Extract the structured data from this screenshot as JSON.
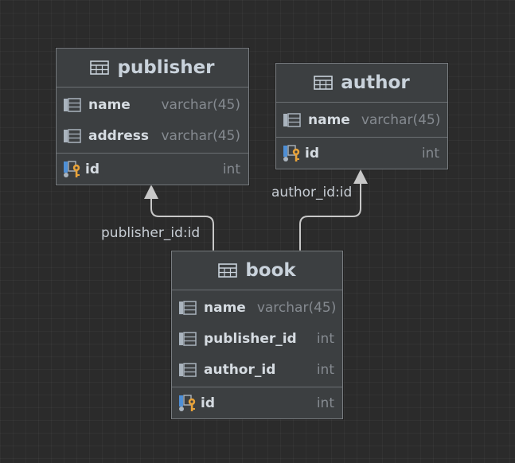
{
  "tables": {
    "publisher": {
      "name": "publisher",
      "columns": [
        {
          "name": "name",
          "type": "varchar(45)"
        },
        {
          "name": "address",
          "type": "varchar(45)"
        }
      ],
      "pk": {
        "name": "id",
        "type": "int"
      }
    },
    "author": {
      "name": "author",
      "columns": [
        {
          "name": "name",
          "type": "varchar(45)"
        }
      ],
      "pk": {
        "name": "id",
        "type": "int"
      }
    },
    "book": {
      "name": "book",
      "columns": [
        {
          "name": "name",
          "type": "varchar(45)"
        },
        {
          "name": "publisher_id",
          "type": "int"
        },
        {
          "name": "author_id",
          "type": "int"
        }
      ],
      "pk": {
        "name": "id",
        "type": "int"
      }
    }
  },
  "relations": {
    "publisher_link": {
      "label": "publisher_id:id",
      "from": "book",
      "to": "publisher"
    },
    "author_link": {
      "label": "author_id:id",
      "from": "book",
      "to": "author"
    }
  },
  "icons": {
    "table": "table-icon",
    "column": "column-icon",
    "primary_key": "primary-key-icon"
  },
  "colors": {
    "background": "#2b2b2b",
    "table_fill": "#3c3f41",
    "table_border": "#7a7e82",
    "link": "#c8c8c8",
    "key_gold": "#e8a33a",
    "key_blue": "#4e8fd6"
  }
}
